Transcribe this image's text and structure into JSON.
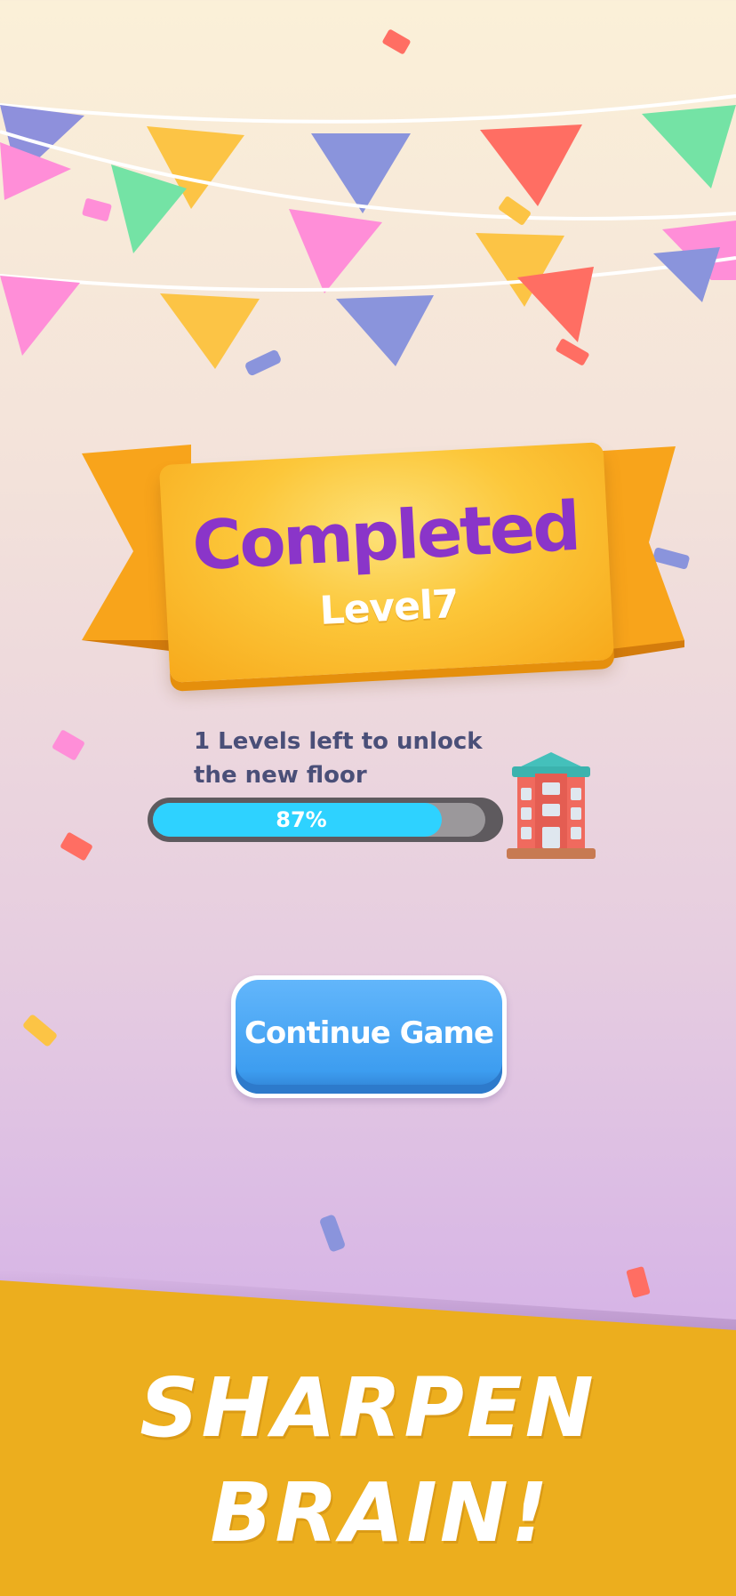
{
  "banner": {
    "title": "Completed",
    "level": "Level7"
  },
  "progress": {
    "message": "1 Levels left to unlock the new floor",
    "percent_label": "87%",
    "percent": 87,
    "icon": "building-icon"
  },
  "continue_button": {
    "label": "Continue Game"
  },
  "tagline": {
    "line1": "SHARPEN",
    "line2": "BRAIN!"
  },
  "colors": {
    "title": "#8a35c9",
    "ribbon": "#fcc73a",
    "progress_fill": "#2ed2ff",
    "button": "#3d9df0",
    "footer": "#ecae1e"
  }
}
